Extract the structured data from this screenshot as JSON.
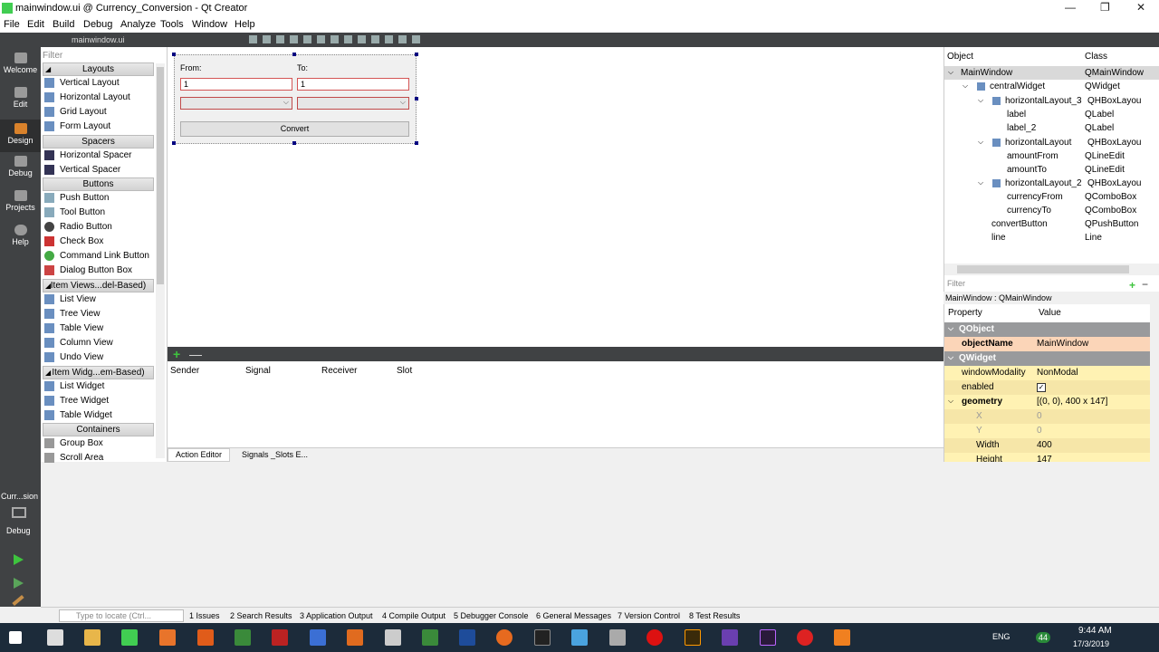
{
  "window": {
    "title": "mainwindow.ui @ Currency_Conversion - Qt Creator",
    "min": "—",
    "max": "❐",
    "close": "✕"
  },
  "menu": [
    "File",
    "Edit",
    "Build",
    "Debug",
    "Analyze",
    "Tools",
    "Window",
    "Help"
  ],
  "modes": [
    {
      "label": "Welcome",
      "icon": "grid-icon"
    },
    {
      "label": "Edit",
      "icon": "document-icon"
    },
    {
      "label": "Design",
      "icon": "pencil-icon"
    },
    {
      "label": "Debug",
      "icon": "bug-icon"
    },
    {
      "label": "Projects",
      "icon": "wrench-icon"
    },
    {
      "label": "Help",
      "icon": "help-icon"
    }
  ],
  "editor": {
    "open_file": "mainwindow.ui"
  },
  "widgetbox": {
    "filter_placeholder": "Filter",
    "categories": {
      "layouts": "Layouts",
      "spacers": "Spacers",
      "buttons": "Buttons",
      "item_views": "Item Views...del-Based)",
      "item_widgets": "Item Widg...em-Based)",
      "containers": "Containers"
    },
    "items": {
      "vertical_layout": "Vertical Layout",
      "horizontal_layout": "Horizontal Layout",
      "grid_layout": "Grid Layout",
      "form_layout": "Form Layout",
      "horizontal_spacer": "Horizontal Spacer",
      "vertical_spacer": "Vertical Spacer",
      "push_button": "Push Button",
      "tool_button": "Tool Button",
      "radio_button": "Radio Button",
      "check_box": "Check Box",
      "command_link_button": "Command Link Button",
      "dialog_button_box": "Dialog Button Box",
      "list_view": "List View",
      "tree_view": "Tree View",
      "table_view": "Table View",
      "column_view": "Column View",
      "undo_view": "Undo View",
      "list_widget": "List Widget",
      "tree_widget": "Tree Widget",
      "table_widget": "Table Widget",
      "group_box": "Group Box",
      "scroll_area": "Scroll Area"
    }
  },
  "form": {
    "from_label": "From:",
    "to_label": "To:",
    "amount_from": "1",
    "amount_to": "1",
    "convert_button": "Convert"
  },
  "signals": {
    "add": "+",
    "remove": "—",
    "headers": {
      "sender": "Sender",
      "signal": "Signal",
      "receiver": "Receiver",
      "slot": "Slot"
    },
    "tabs": {
      "action_editor": "Action Editor",
      "signals_slots": "Signals _Slots E..."
    }
  },
  "object_inspector": {
    "headers": {
      "object": "Object",
      "class": "Class"
    },
    "rows": [
      {
        "name": "MainWindow",
        "cls": "QMainWindow"
      },
      {
        "name": "centralWidget",
        "cls": "QWidget"
      },
      {
        "name": "horizontalLayout_3",
        "cls": "QHBoxLayou"
      },
      {
        "name": "label",
        "cls": "QLabel"
      },
      {
        "name": "label_2",
        "cls": "QLabel"
      },
      {
        "name": "horizontalLayout",
        "cls": "QHBoxLayou"
      },
      {
        "name": "amountFrom",
        "cls": "QLineEdit"
      },
      {
        "name": "amountTo",
        "cls": "QLineEdit"
      },
      {
        "name": "horizontalLayout_2",
        "cls": "QHBoxLayou"
      },
      {
        "name": "currencyFrom",
        "cls": "QComboBox"
      },
      {
        "name": "currencyTo",
        "cls": "QComboBox"
      },
      {
        "name": "convertButton",
        "cls": "QPushButton"
      },
      {
        "name": "line",
        "cls": "Line"
      }
    ]
  },
  "property_editor": {
    "filter_placeholder": "Filter",
    "class_label": "MainWindow : QMainWindow",
    "headers": {
      "property": "Property",
      "value": "Value"
    },
    "groups": {
      "qobject": "QObject",
      "qwidget": "QWidget"
    },
    "rows": {
      "objectName": {
        "k": "objectName",
        "v": "MainWindow"
      },
      "windowModality": {
        "k": "windowModality",
        "v": "NonModal"
      },
      "enabled": {
        "k": "enabled",
        "v": "✓"
      },
      "geometry": {
        "k": "geometry",
        "v": "[(0, 0), 400 x 147]"
      },
      "x": {
        "k": "X",
        "v": "0"
      },
      "y": {
        "k": "Y",
        "v": "0"
      },
      "width": {
        "k": "Width",
        "v": "400"
      },
      "height": {
        "k": "Height",
        "v": "147"
      }
    }
  },
  "run_panel": {
    "project": "Curr...sion",
    "mode": "Debug"
  },
  "output": {
    "locate_placeholder": "Type to locate (Ctrl...",
    "tabs": [
      "1 Issues",
      "2 Search Results",
      "3 Application Output",
      "4 Compile Output",
      "5 Debugger Console",
      "6 General Messages",
      "7 Version Control",
      "8 Test Results"
    ]
  },
  "taskbar": {
    "lang": "ENG",
    "time": "9:44 AM",
    "date": "17/3/2019",
    "badge": "44"
  }
}
